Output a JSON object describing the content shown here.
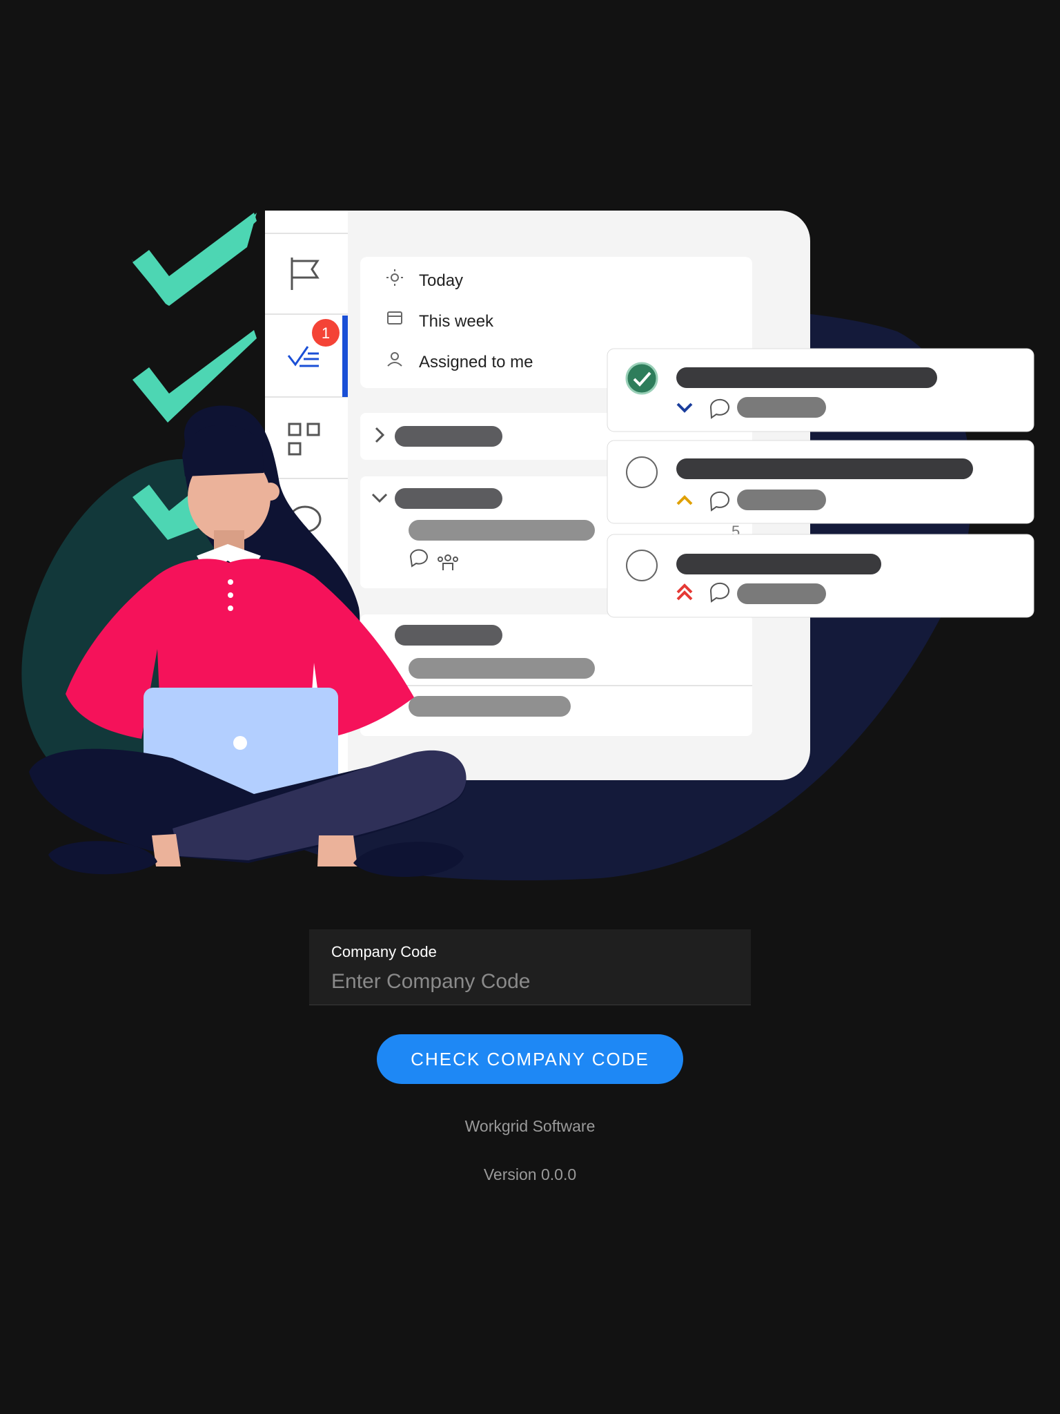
{
  "illustration": {
    "menu": {
      "items": [
        {
          "label": "Today",
          "icon": "sun-icon"
        },
        {
          "label": "This week",
          "icon": "calendar-icon"
        },
        {
          "label": "Assigned to me",
          "icon": "user-icon"
        }
      ]
    },
    "nav_icons": [
      "flag-icon",
      "tasks-icon",
      "apps-icon",
      "chat-icon"
    ],
    "task_badge": "1",
    "count": "5"
  },
  "form": {
    "label": "Company Code",
    "placeholder": "Enter Company Code",
    "value": "",
    "button_label": "CHECK COMPANY CODE"
  },
  "footer": {
    "company": "Workgrid Software",
    "version": "Version 0.0.0"
  },
  "colors": {
    "background": "#121212",
    "accent": "#1e88f5",
    "check_green": "#4dd6b3",
    "badge_red": "#f44336"
  }
}
